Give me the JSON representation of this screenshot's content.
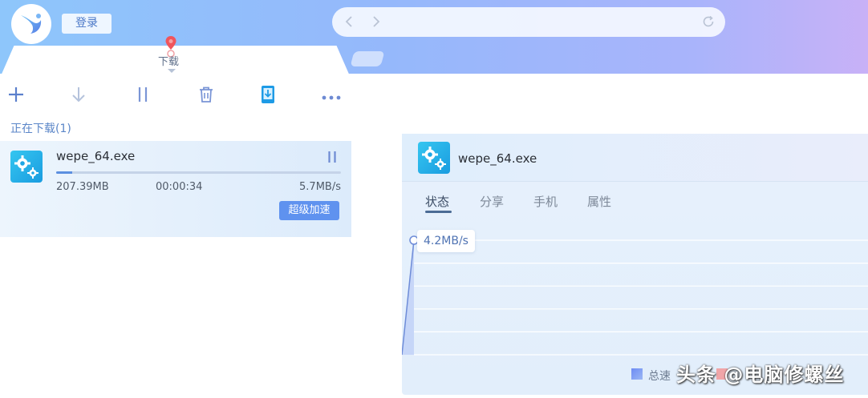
{
  "header": {
    "login_label": "登录",
    "active_tab_label": "下载"
  },
  "toolbar": {
    "items": [
      {
        "name": "add",
        "icon": "plus-icon"
      },
      {
        "name": "download",
        "icon": "download-arrow-icon"
      },
      {
        "name": "pause-all",
        "icon": "pause-icon"
      },
      {
        "name": "delete",
        "icon": "trash-icon"
      },
      {
        "name": "mobile",
        "icon": "phone-transfer-icon"
      },
      {
        "name": "more",
        "icon": "more-dots-icon"
      }
    ]
  },
  "section_title": "正在下载(1)",
  "download_item": {
    "file_name": "wepe_64.exe",
    "size": "207.39MB",
    "elapsed": "00:00:34",
    "speed": "5.7MB/s",
    "boost_label": "超级加速",
    "progress_fraction": 0.055
  },
  "details": {
    "file_name": "wepe_64.exe",
    "tabs": [
      "状态",
      "分享",
      "手机",
      "属性"
    ],
    "active_tab": 0,
    "current_speed": "4.2MB/s",
    "legend_total": "总速"
  },
  "chart_data": {
    "type": "area",
    "x": [
      0,
      1
    ],
    "values": [
      0,
      4.2
    ],
    "title": "",
    "xlabel": "",
    "ylabel": "",
    "grid": true
  },
  "watermark": "头条 @电脑修螺丝",
  "colors": {
    "accent": "#5f92ef",
    "section_title": "#5b86c8",
    "header_gradient_start": "#8ec6fb",
    "header_gradient_end": "#c8b1f7"
  }
}
